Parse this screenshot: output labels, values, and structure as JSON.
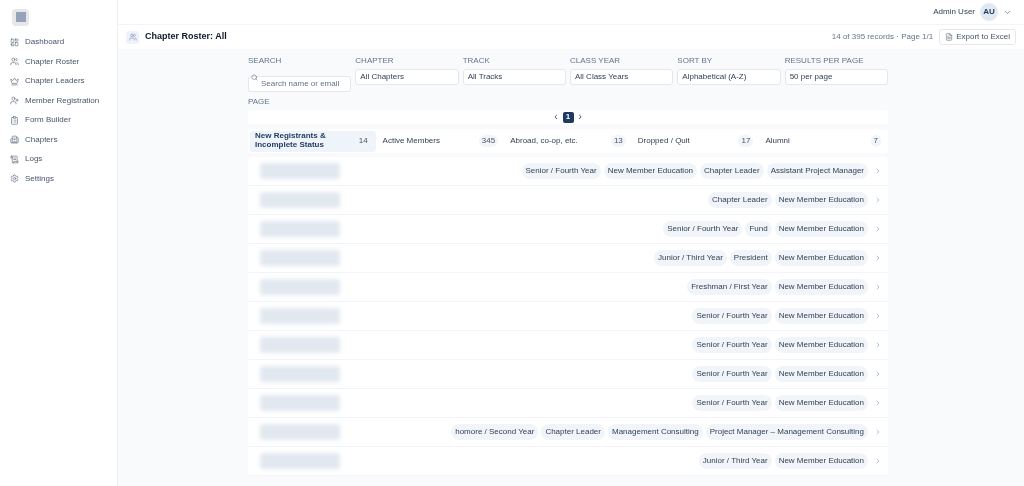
{
  "header": {
    "user_name": "Admin User",
    "avatar_initials": "AU"
  },
  "sidebar": {
    "items": [
      {
        "label": "Dashboard",
        "selected": false
      },
      {
        "label": "Chapter Roster",
        "selected": false
      },
      {
        "label": "Chapter Leaders",
        "selected": false
      },
      {
        "label": "Member Registration",
        "selected": false
      },
      {
        "label": "Form Builder",
        "selected": false
      },
      {
        "label": "Chapters",
        "selected": false
      },
      {
        "label": "Logs",
        "selected": false
      },
      {
        "label": "Settings",
        "selected": false
      }
    ]
  },
  "page": {
    "title": "Chapter Roster: All",
    "records": "14 of 395 records · Page 1/1",
    "export_button": "Export to Excel"
  },
  "filters": [
    {
      "label": "SEARCH",
      "kind": "search",
      "placeholder": "Search name or email"
    },
    {
      "label": "CHAPTER",
      "kind": "select",
      "value": "All Chapters"
    },
    {
      "label": "TRACK",
      "kind": "select",
      "value": "All Tracks"
    },
    {
      "label": "CLASS YEAR",
      "kind": "select",
      "value": "All Class Years"
    },
    {
      "label": "SORT BY",
      "kind": "select",
      "value": "Alphabetical (A-Z)"
    },
    {
      "label": "RESULTS PER PAGE",
      "kind": "select",
      "value": "50 per page"
    }
  ],
  "pagination": {
    "label": "PAGE",
    "prev": "‹",
    "next": "›",
    "pages": [
      {
        "label": "1",
        "selected": true
      }
    ]
  },
  "tabs": [
    {
      "label": "New Registrants & Incomplete Status",
      "count": "14",
      "selected": true
    },
    {
      "label": "Active Members",
      "count": "345",
      "selected": false
    },
    {
      "label": "Abroad, co-op, etc.",
      "count": "13",
      "selected": false
    },
    {
      "label": "Dropped / Quit",
      "count": "17",
      "selected": false
    },
    {
      "label": "Alumni",
      "count": "7",
      "selected": false
    }
  ],
  "rows": [
    {
      "tags": [
        "Senior / Fourth Year",
        "New Member Education",
        "Chapter Leader",
        "Assistant Project Manager"
      ]
    },
    {
      "tags": [
        "Chapter Leader",
        "New Member Education"
      ]
    },
    {
      "tags": [
        "Senior / Fourth Year",
        "Fund",
        "New Member Education"
      ]
    },
    {
      "tags": [
        "Junior / Third Year",
        "President",
        "New Member Education"
      ]
    },
    {
      "tags": [
        "Freshman / First Year",
        "New Member Education"
      ]
    },
    {
      "tags": [
        "Senior / Fourth Year",
        "New Member Education"
      ]
    },
    {
      "tags": [
        "Senior / Fourth Year",
        "New Member Education"
      ]
    },
    {
      "tags": [
        "Senior / Fourth Year",
        "New Member Education"
      ]
    },
    {
      "tags": [
        "Senior / Fourth Year",
        "New Member Education"
      ]
    },
    {
      "tags": [
        "homore / Second Year",
        "Chapter Leader",
        "Management Consulting",
        "Project Manager – Management Consulting"
      ]
    },
    {
      "tags": [
        "Junior / Third Year",
        "New Member Education"
      ]
    }
  ]
}
